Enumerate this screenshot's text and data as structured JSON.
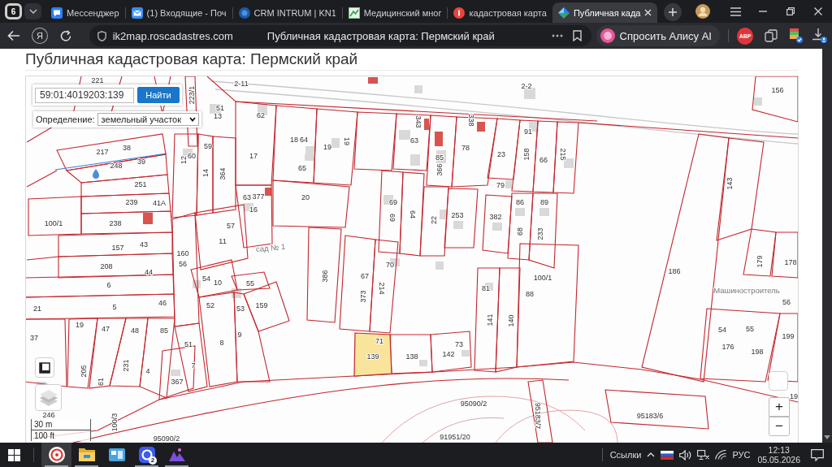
{
  "browser": {
    "tab_count": "6",
    "tabs": [
      {
        "kind": "chat",
        "title": "Мессенджер",
        "selected": false
      },
      {
        "kind": "mail",
        "title": "(1) Входящие - Поч",
        "selected": false
      },
      {
        "kind": "crm",
        "title": "CRM INTRUM | KN1",
        "selected": false
      },
      {
        "kind": "doc",
        "title": "Медицинский мног",
        "selected": false
      },
      {
        "kind": "yandex",
        "title": "кадастровая карта",
        "selected": false
      },
      {
        "kind": "cadastre",
        "title": "Публичная када",
        "selected": true
      }
    ],
    "home_button": "Я",
    "address": {
      "url": "ik2map.roscadastres.com",
      "page_title": "Публичная кадастровая карта: Пермский край"
    },
    "alice_button": "Спросить Алису AI",
    "extension_label": "ABP"
  },
  "page": {
    "heading": "Публичная кадастровая карта: Пермский край"
  },
  "map": {
    "search": {
      "value": "59:01:4019203:139",
      "button": "Найти"
    },
    "definition": {
      "label": "Определение:",
      "value": "земельный участок"
    },
    "selection_highlight": true,
    "parcel_numbers": [
      "221",
      "2-11",
      "223/1",
      "51",
      "13",
      "62",
      "2-2",
      "156",
      "343",
      "338",
      "91",
      "18",
      "64",
      "19",
      "19",
      "63",
      "78",
      "23",
      "158",
      "66",
      "215",
      "217",
      "38",
      "39",
      "12",
      "60",
      "59",
      "17",
      "85",
      "366",
      "65",
      "248",
      "14",
      "364",
      "143",
      "251",
      "79",
      "239",
      "41А",
      "63",
      "377",
      "20",
      "69",
      "86",
      "89",
      "16",
      "100/1",
      "238",
      "69",
      "64",
      "22",
      "253",
      "382",
      "57",
      "68",
      "233",
      "157",
      "43",
      "11",
      "160",
      "56",
      "179",
      "178",
      "208",
      "44",
      "186",
      "70",
      "6",
      "386",
      "67",
      "54",
      "10",
      "55",
      "100/1",
      "214",
      "81",
      "88",
      "373",
      "5",
      "46",
      "52",
      "53",
      "159",
      "56",
      "21",
      "141",
      "140",
      "19",
      "47",
      "48",
      "85",
      "54",
      "55",
      "37",
      "9",
      "199",
      "51",
      "8",
      "71",
      "73",
      "176",
      "198",
      "139",
      "138",
      "142",
      "7",
      "231",
      "4",
      "205",
      "367",
      "61",
      "95090/2",
      "19",
      "95183/7",
      "95183/6",
      "246",
      "100/3",
      "91951/20",
      "95090/2"
    ],
    "place_names": [
      "сад № 1",
      "Машиностроитель"
    ],
    "scale": {
      "metric": "30 m",
      "imperial": "100 ft"
    },
    "zoom_in": "+",
    "zoom_out": "−"
  },
  "taskbar": {
    "apps": [
      {
        "kind": "browser",
        "selected": true,
        "running": true
      },
      {
        "kind": "folder",
        "selected": false,
        "running": true
      },
      {
        "kind": "window",
        "selected": false,
        "running": false
      },
      {
        "kind": "messenger",
        "selected": false,
        "running": true,
        "badge": "2"
      },
      {
        "kind": "creative",
        "selected": false,
        "running": true
      }
    ],
    "links_label": "Ссылки",
    "language": "РУС",
    "time": "12:13",
    "date": "05.05.2026"
  }
}
